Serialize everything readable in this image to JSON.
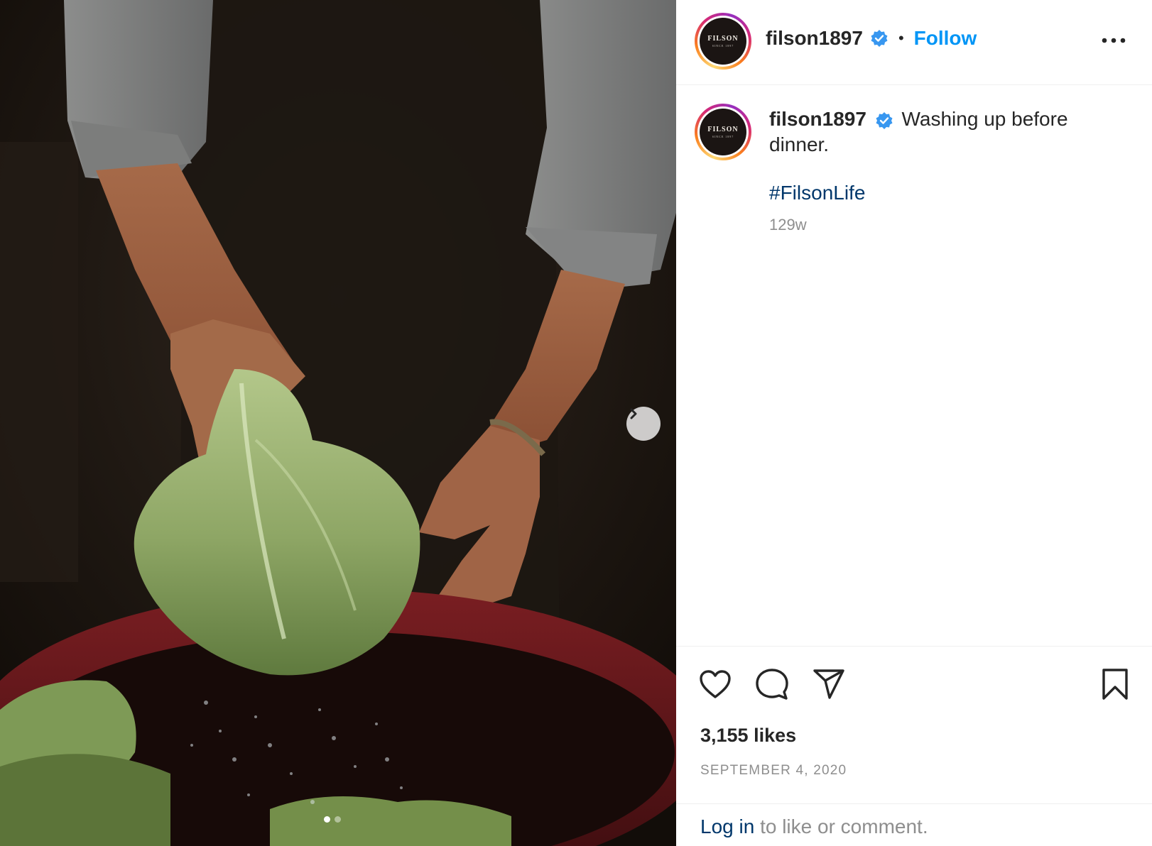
{
  "post": {
    "username": "filson1897",
    "follow_label": "Follow",
    "separator": "•",
    "avatar": {
      "brand_text": "FILSON",
      "since_text": "SINCE 1897"
    },
    "caption": {
      "text": "Washing up before dinner.",
      "hashtag": "#FilsonLife",
      "time_ago": "129w"
    },
    "likes": "3,155 likes",
    "date": "SEPTEMBER 4, 2020",
    "login_prompt": {
      "link": "Log in",
      "rest": " to like or comment."
    }
  },
  "carousel": {
    "slide_count": 2,
    "active_index": 0
  },
  "icons": {
    "verified": "verified-badge-icon",
    "more": "more-options-icon",
    "like": "heart-icon",
    "comment": "comment-icon",
    "share": "share-icon",
    "save": "bookmark-icon",
    "next": "chevron-right-icon"
  },
  "colors": {
    "accent": "#0095f6",
    "hashtag": "#00376b",
    "muted": "#8e8e8e",
    "text": "#262626",
    "verified": "#3897f0"
  }
}
